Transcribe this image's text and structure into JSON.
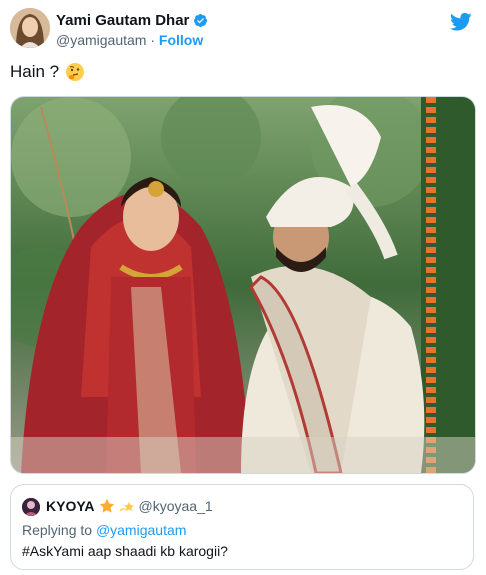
{
  "author": {
    "display_name": "Yami Gautam Dhar",
    "handle": "@yamigautam",
    "separator": "·",
    "follow_label": "Follow",
    "verified_icon": "verified-badge-icon"
  },
  "tweet": {
    "text": "Hain ?",
    "emoji": "thinking-face-icon"
  },
  "media": {
    "description_icon": "wedding-photo"
  },
  "quoted_tweet": {
    "display_name": "KYOYA",
    "emoji_icons": [
      "star-icon",
      "dizzy-star-icon"
    ],
    "handle": "@kyoyaa_1",
    "replying_prefix": "Replying to",
    "replying_to": "@yamigautam",
    "text": "#AskYami aap shaadi kb karogii?"
  },
  "colors": {
    "accent": "#1d9bf0",
    "text": "#0f1419",
    "secondary": "#536471",
    "border": "#cfd9de"
  }
}
